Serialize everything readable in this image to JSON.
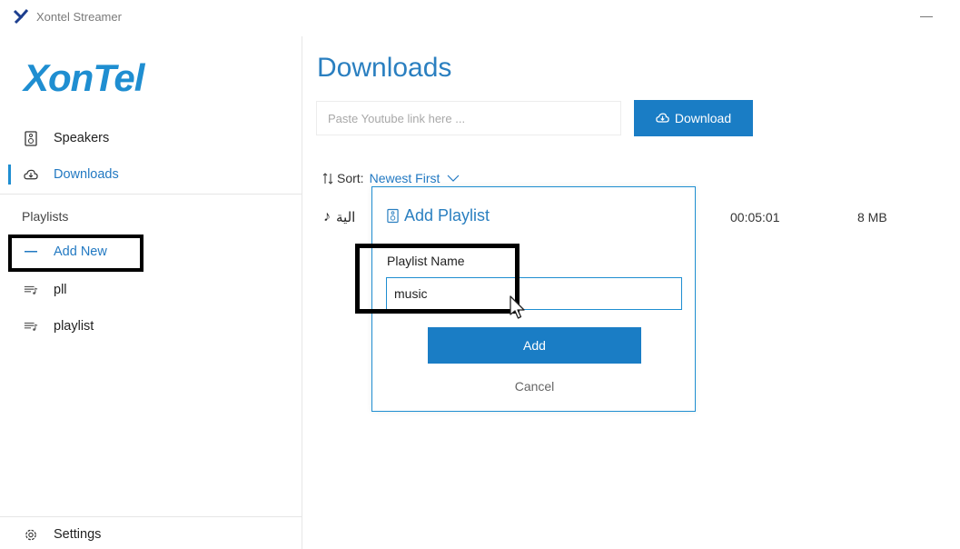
{
  "app": {
    "title": "Xontel Streamer"
  },
  "sidebar": {
    "brand": "XonTel",
    "items": [
      {
        "label": "Speakers",
        "icon": "speaker-icon"
      },
      {
        "label": "Downloads",
        "icon": "cloud-download-icon",
        "active": true
      }
    ],
    "playlists_header": "Playlists",
    "add_new_label": "Add New",
    "playlists": [
      {
        "label": "pll",
        "icon": "playlist-icon"
      },
      {
        "label": "playlist",
        "icon": "playlist-icon"
      }
    ],
    "settings_label": "Settings"
  },
  "main": {
    "title": "Downloads",
    "link_placeholder": "Paste Youtube link here ...",
    "download_label": "Download",
    "sort_label": "Sort:",
    "sort_value": "Newest First",
    "track": {
      "title": "الية",
      "duration": "00:05:01",
      "size": "8 MB"
    }
  },
  "dialog": {
    "title": "Add Playlist",
    "field_label": "Playlist Name",
    "field_value": "music",
    "add_label": "Add",
    "cancel_label": "Cancel"
  },
  "colors": {
    "accent": "#1a7dc5",
    "link": "#2279c2"
  }
}
